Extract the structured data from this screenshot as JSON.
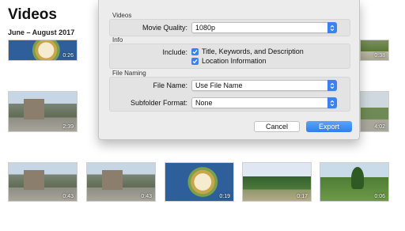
{
  "library": {
    "title": "Videos",
    "date_range": "June – August 2017",
    "thumbnails": [
      {
        "duration": "0:26",
        "scene": "scene-food"
      },
      {
        "duration": "0:38",
        "scene": "scene-tree"
      },
      {
        "duration": "2:39",
        "scene": "scene-house"
      },
      {
        "duration": "4:02",
        "scene": "scene-street"
      },
      {
        "duration": "0:43",
        "scene": "scene-house"
      },
      {
        "duration": "0:43",
        "scene": "scene-house"
      },
      {
        "duration": "0:19",
        "scene": "scene-food"
      },
      {
        "duration": "0:17",
        "scene": "scene-park"
      },
      {
        "duration": "0:06",
        "scene": "scene-lawn"
      }
    ]
  },
  "export_dialog": {
    "videos_section": {
      "header": "Videos",
      "movie_quality_label": "Movie Quality:",
      "movie_quality_value": "1080p"
    },
    "info_section": {
      "header": "Info",
      "include_label": "Include:",
      "option_title_keywords": "Title, Keywords, and Description",
      "option_title_keywords_checked": true,
      "option_location": "Location Information",
      "option_location_checked": true
    },
    "file_naming_section": {
      "header": "File Naming",
      "file_name_label": "File Name:",
      "file_name_value": "Use File Name",
      "subfolder_label": "Subfolder Format:",
      "subfolder_value": "None"
    },
    "cancel_label": "Cancel",
    "export_label": "Export"
  },
  "colors": {
    "accent": "#3b82f0",
    "sheet_background": "#ececec"
  }
}
